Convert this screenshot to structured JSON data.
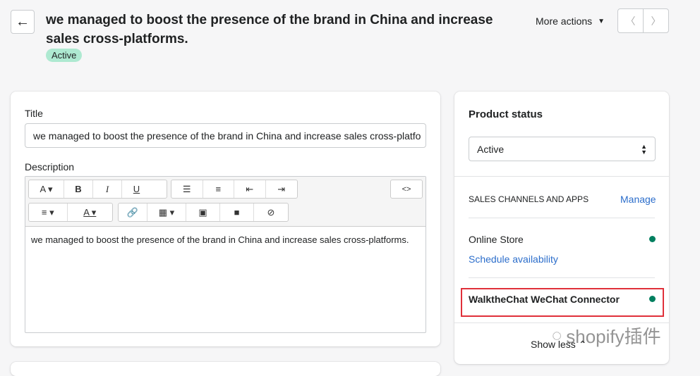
{
  "header": {
    "title": "we managed to boost the presence of the brand in China and increase sales cross-platforms.",
    "status_badge": "Active",
    "more_actions": "More actions"
  },
  "product": {
    "title_label": "Title",
    "title_value": "we managed to boost the presence of the brand in China and increase sales cross-platfo",
    "description_label": "Description",
    "description_value": "we managed to boost the presence of the brand in China and increase sales cross-platforms.",
    "toolbar": {
      "row1": [
        "A ▾",
        "B",
        "I",
        "U",
        "☰",
        "≡",
        "⇤",
        "⇥"
      ],
      "code": "<>",
      "row2": [
        "≡ ▾",
        "A ▾",
        "🔗",
        "▦ ▾",
        "▣",
        "■",
        "⊘"
      ]
    }
  },
  "status_card": {
    "title": "Product status",
    "select_value": "Active",
    "channels_heading": "SALES CHANNELS AND APPS",
    "manage": "Manage",
    "channels": [
      {
        "name": "Online Store",
        "link": "Schedule availability",
        "status_color": "#007f5f"
      },
      {
        "name": "WalktheChat WeChat Connector",
        "status_color": "#007f5f"
      }
    ],
    "show_less": "Show less"
  },
  "watermark": "shopify插件"
}
